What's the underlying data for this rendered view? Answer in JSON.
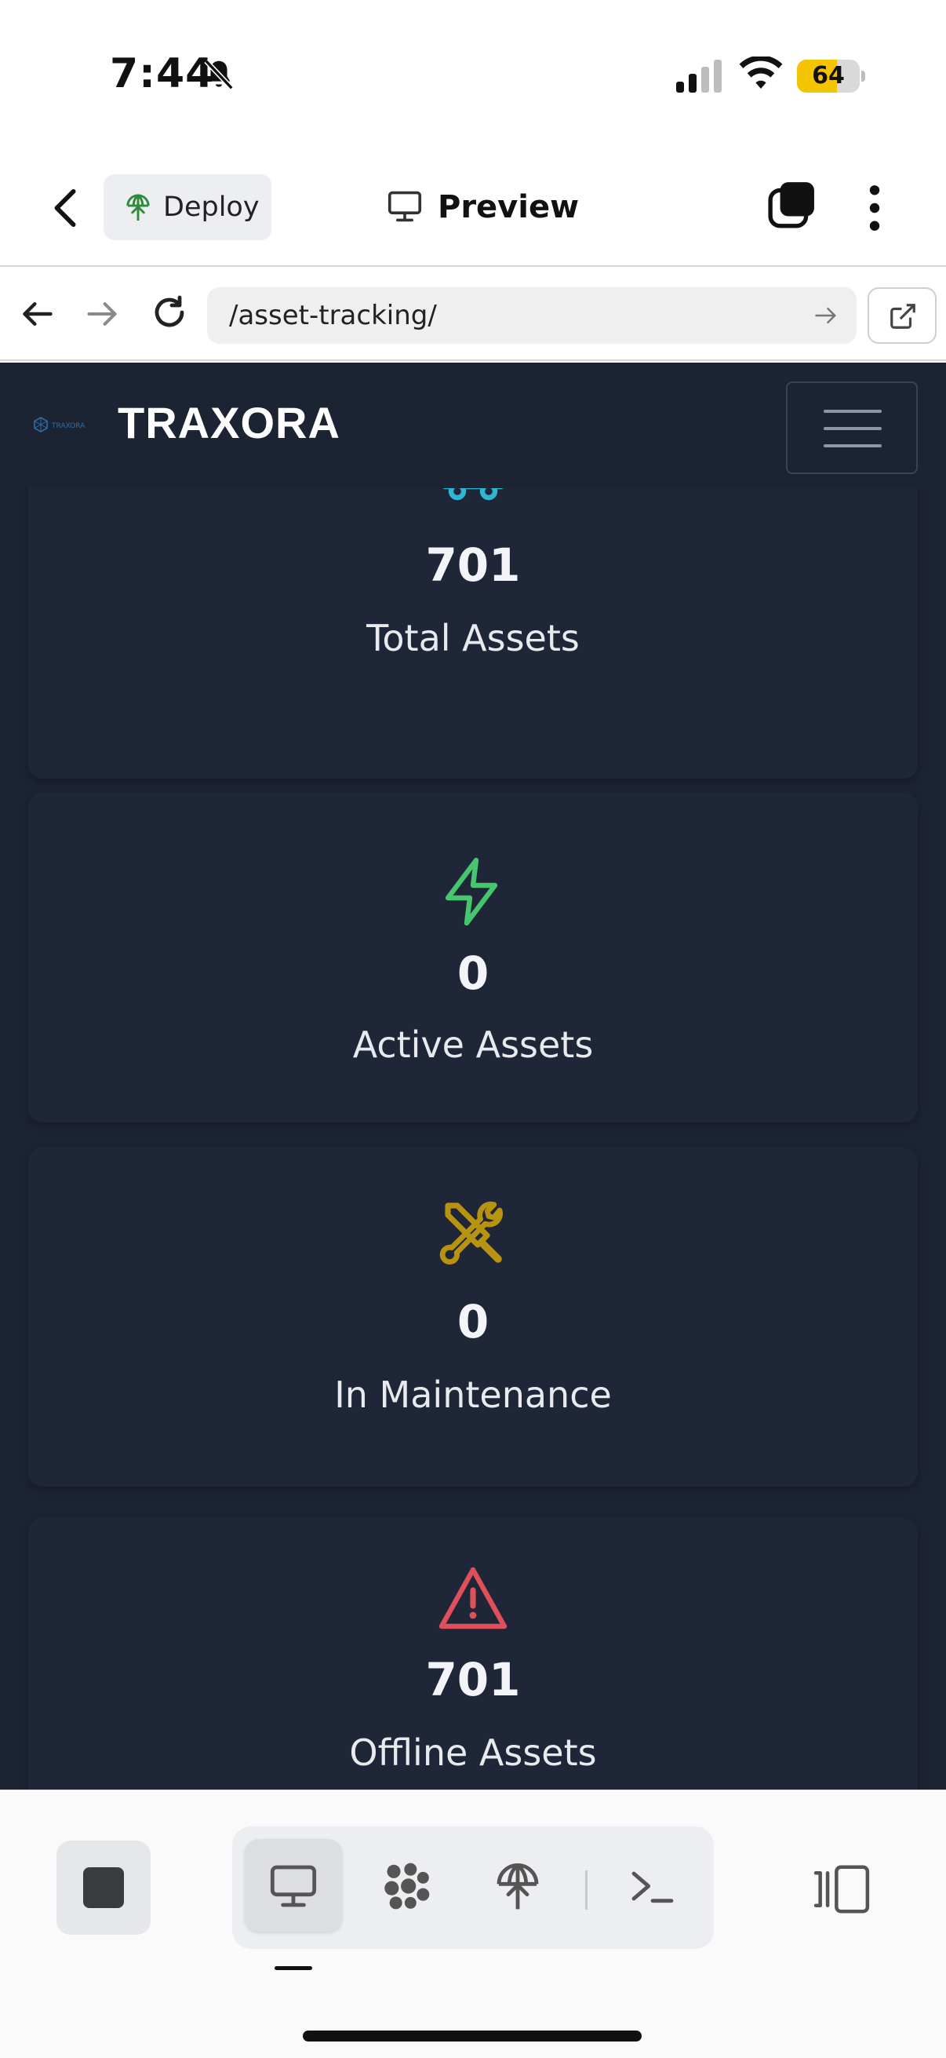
{
  "status_bar": {
    "time": "7:44",
    "battery_level": "64",
    "battery_fraction": 0.64,
    "icons": [
      "bell-slash-icon",
      "cellular-signal-icon",
      "wifi-icon",
      "battery-icon"
    ]
  },
  "app_bar": {
    "deploy_label": "Deploy",
    "preview_label": "Preview",
    "icons": [
      "chevron-left-icon",
      "deploy-globe-icon",
      "monitor-icon",
      "tabs-icon",
      "more-vertical-icon"
    ]
  },
  "browser": {
    "url": "/asset-tracking/",
    "icons": [
      "arrow-left-icon",
      "arrow-right-icon",
      "reload-icon",
      "arrow-go-icon",
      "external-link-icon"
    ]
  },
  "site": {
    "brand_name": "TRAXORA",
    "logo_text": "TRAXORA",
    "menu_icon": "hamburger-icon"
  },
  "stats": [
    {
      "value": "701",
      "label": "Total Assets",
      "icon": "truck-icon",
      "color": "#2fb6d2"
    },
    {
      "value": "0",
      "label": "Active Assets",
      "icon": "lightning-icon",
      "color": "#46c66e"
    },
    {
      "value": "0",
      "label": "In Maintenance",
      "icon": "tools-icon",
      "color": "#b8930f"
    },
    {
      "value": "701",
      "label": "Offline Assets",
      "icon": "warning-icon",
      "color": "#e0505a"
    }
  ],
  "bottom_toolbar": {
    "active_tool": "preview",
    "tools": [
      "monitor-icon",
      "assets-dots-icon",
      "deploy-globe-icon",
      "terminal-icon"
    ],
    "icons": [
      "stop-icon",
      "panel-toggle-icon"
    ]
  },
  "colors": {
    "web_background": "#1c2333",
    "card_background": "#1f2637",
    "battery": "#f5c400",
    "deploy_green": "#2e8b3a"
  }
}
